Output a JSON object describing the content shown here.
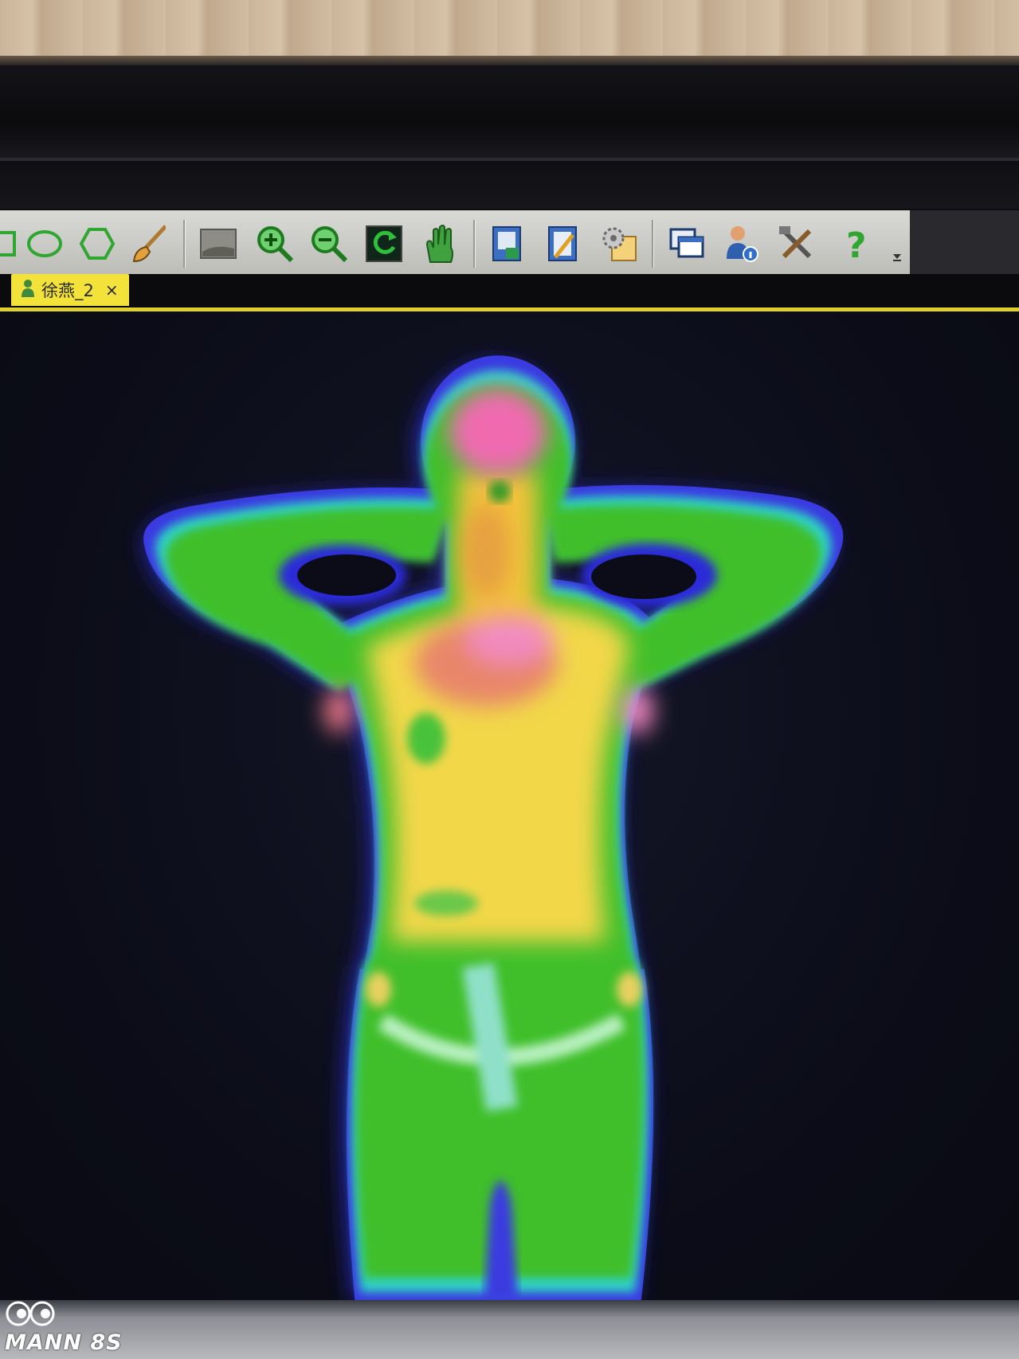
{
  "toolbar": {
    "icons": [
      {
        "name": "rectangle-select-icon"
      },
      {
        "name": "ellipse-select-icon"
      },
      {
        "name": "polygon-select-icon"
      },
      {
        "name": "brush-icon"
      },
      {
        "name": "image-view-icon"
      },
      {
        "name": "zoom-in-icon"
      },
      {
        "name": "zoom-out-icon"
      },
      {
        "name": "refresh-icon"
      },
      {
        "name": "pan-hand-icon"
      },
      {
        "name": "report-icon"
      },
      {
        "name": "edit-icon"
      },
      {
        "name": "settings-icon"
      },
      {
        "name": "window-icon"
      },
      {
        "name": "user-info-icon"
      },
      {
        "name": "tools-icon"
      },
      {
        "name": "help-icon"
      }
    ]
  },
  "tabs": [
    {
      "label": "徐燕_2",
      "close": "×"
    }
  ],
  "watermark": {
    "text": "MANN 8S"
  },
  "colors": {
    "tab_active": "#f2e23a",
    "thermal_hot": "#f06bb0",
    "thermal_warm": "#f2d74a",
    "thermal_mid": "#3fbf2a",
    "thermal_cool": "#2fd1c4",
    "thermal_edge": "#3a3ae0"
  }
}
